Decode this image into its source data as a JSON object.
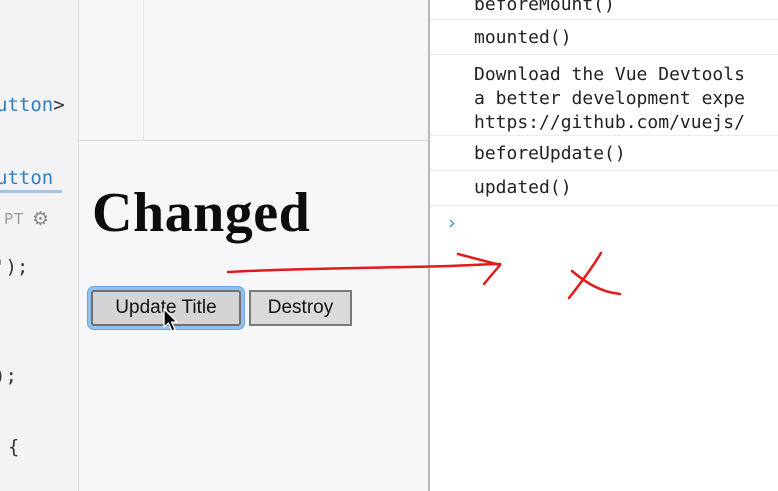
{
  "editor": {
    "lines": {
      "l1": "utton",
      "l1b": ">",
      "l2": "utton",
      "l3": "');",
      "l4": ");",
      "l5": "{"
    },
    "tab_text": "PT",
    "gear_icon": "gear-icon"
  },
  "preview": {
    "title": "Changed",
    "update_button_label": "Update Title",
    "destroy_button_label": "Destroy"
  },
  "console": {
    "logs": [
      {
        "text": "beforeMount()"
      },
      {
        "text": "mounted()"
      },
      {
        "text": "Download the Vue Devtools\na better development expe\nhttps://github.com/vuejs/"
      },
      {
        "text": "beforeUpdate()"
      },
      {
        "text": "updated()"
      }
    ],
    "prompt_symbol": "›"
  },
  "colors": {
    "keyword_blue": "#2f7fc1",
    "focus_ring": "#8ec0f2",
    "annotation_red": "#e11a1a"
  }
}
